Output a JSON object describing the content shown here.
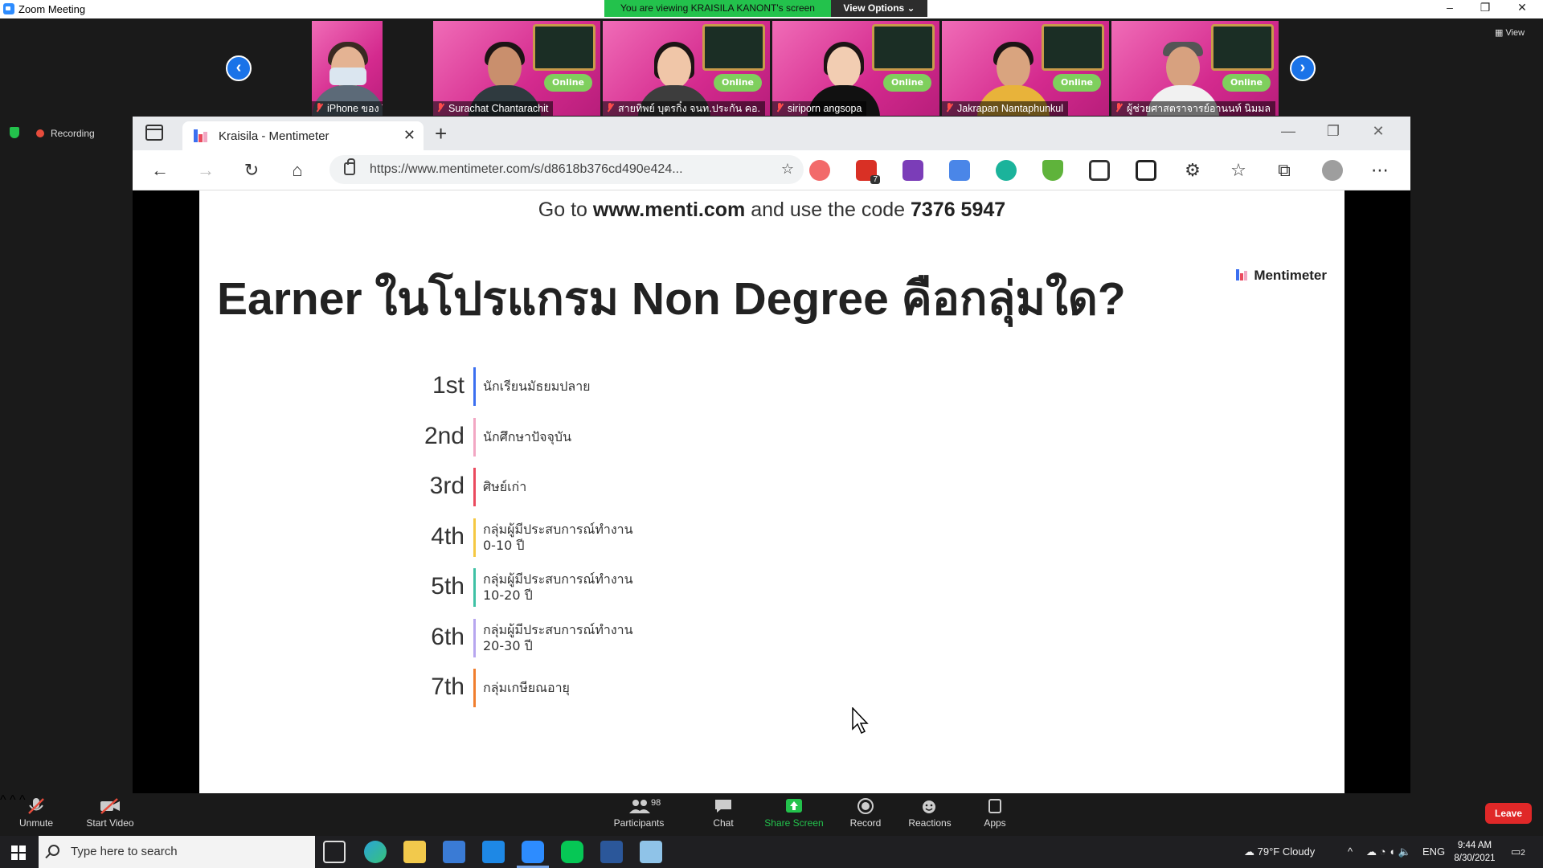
{
  "zoom": {
    "window_title": "Zoom Meeting",
    "viewing_banner": "You are viewing KRAISILA KANONT's screen",
    "view_options": "View Options ⌄",
    "view_label": "View",
    "recording_label": "Recording",
    "window_controls": [
      "–",
      "❐",
      "✕"
    ]
  },
  "gallery": {
    "prev_arrow": "‹",
    "next_arrow": "›",
    "participants": [
      {
        "name": "iPhone ของ Thanarat"
      },
      {
        "name": "Surachat Chantarachit"
      },
      {
        "name": "สายทิพย์ บุตรกิ๋ง จนท.ประกัน คอ."
      },
      {
        "name": "siriporn angsopa"
      },
      {
        "name": "Jakrapan Nantaphunkul"
      },
      {
        "name": "ผู้ช่วยศาสตราจารย์อานนท์ นิมมล"
      }
    ],
    "tile_badge": "Online"
  },
  "browser": {
    "tab_title": "Kraisila - Mentimeter",
    "url": "https://www.mentimeter.com/s/d8618b376cd490e424...",
    "new_tab": "+",
    "tab_close": "✕",
    "win_controls": [
      "—",
      "❐",
      "✕"
    ],
    "ext_badge": "7"
  },
  "slide": {
    "join_prefix": "Go to ",
    "join_url": "www.menti.com",
    "join_mid": " and use the code ",
    "join_code": "7376 5947",
    "question": "Earner ในโปรแกรม Non Degree คือกลุ่มใด?",
    "brand": "Mentimeter",
    "rankings": [
      {
        "rank": "1st",
        "label": "นักเรียนมัธยมปลาย",
        "color": "#3b6ff0"
      },
      {
        "rank": "2nd",
        "label": "นักศึกษาปัจจุบัน",
        "color": "#f2a7c3"
      },
      {
        "rank": "3rd",
        "label": "ศิษย์เก่า",
        "color": "#ea4a5e"
      },
      {
        "rank": "4th",
        "label": "กลุ่มผู้มีประสบการณ์ทำงาน\n0-10 ปี",
        "color": "#f5c842"
      },
      {
        "rank": "5th",
        "label": "กลุ่มผู้มีประสบการณ์ทำงาน\n10-20 ปี",
        "color": "#3fc1a5"
      },
      {
        "rank": "6th",
        "label": "กลุ่มผู้มีประสบการณ์ทำงาน\n20-30 ปี",
        "color": "#b7a6ef"
      },
      {
        "rank": "7th",
        "label": "กลุ่มเกษียณอายุ",
        "color": "#f07e2e"
      }
    ]
  },
  "controls": {
    "unmute": "Unmute",
    "start_video": "Start Video",
    "participants": "Participants",
    "participant_count": "98",
    "chat": "Chat",
    "share_screen": "Share Screen",
    "record": "Record",
    "reactions": "Reactions",
    "apps": "Apps",
    "leave": "Leave"
  },
  "taskbar": {
    "search_placeholder": "Type here to search",
    "weather": "79°F  Cloudy",
    "language": "ENG",
    "time": "9:44 AM",
    "date": "8/30/2021",
    "notification_count": "2"
  }
}
